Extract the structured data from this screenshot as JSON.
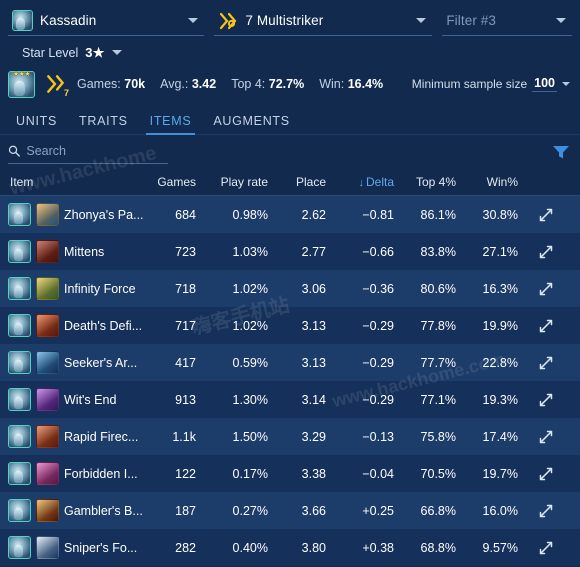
{
  "filters": {
    "champion": {
      "name": "Kassadin",
      "icon": "champion-portrait-icon"
    },
    "trait": {
      "name": "7 Multistriker",
      "icon": "multistriker-trait-icon"
    },
    "third": {
      "placeholder": "Filter #3"
    },
    "star_level": {
      "label": "Star Level",
      "value": "3★"
    }
  },
  "stats": {
    "games_label": "Games:",
    "games_value": "70k",
    "avg_label": "Avg.:",
    "avg_value": "3.42",
    "top4_label": "Top 4:",
    "top4_value": "72.7%",
    "win_label": "Win:",
    "win_value": "16.4%",
    "trait_count": "7",
    "min_sample_label": "Minimum sample size",
    "min_sample_value": "100"
  },
  "tabs": [
    {
      "label": "UNITS",
      "active": false
    },
    {
      "label": "TRAITS",
      "active": false
    },
    {
      "label": "ITEMS",
      "active": true
    },
    {
      "label": "AUGMENTS",
      "active": false
    }
  ],
  "search": {
    "placeholder": "Search",
    "value": ""
  },
  "columns": {
    "item": "Item",
    "games": "Games",
    "play_rate": "Play rate",
    "place": "Place",
    "delta": "Delta",
    "delta_sort": "↓",
    "top4": "Top 4%",
    "win": "Win%"
  },
  "colors": {
    "page_bg": "#122a4d",
    "row_odd": "#1c3c69",
    "row_even": "#15305a",
    "accent_blue": "#3f8fe0",
    "sort_blue": "#63a8ef",
    "trait_gold": "#f5c518",
    "champ_border": "#4fd4c0"
  },
  "rows": [
    {
      "name": "Zhonya's Pa...",
      "games": "684",
      "play_rate": "0.98%",
      "place": "2.62",
      "delta": "−0.81",
      "top4": "86.1%",
      "win": "30.8%",
      "item_color_a": "#e8a23a",
      "item_color_b": "#2b6ea8"
    },
    {
      "name": "Mittens",
      "games": "723",
      "play_rate": "1.03%",
      "place": "2.77",
      "delta": "−0.66",
      "top4": "83.8%",
      "win": "27.1%",
      "item_color_a": "#b5402c",
      "item_color_b": "#5c1a14"
    },
    {
      "name": "Infinity Force",
      "games": "718",
      "play_rate": "1.02%",
      "place": "3.06",
      "delta": "−0.36",
      "top4": "80.6%",
      "win": "16.3%",
      "item_color_a": "#e8c23a",
      "item_color_b": "#3e7a3a"
    },
    {
      "name": "Death's Defi...",
      "games": "717",
      "play_rate": "1.02%",
      "place": "3.13",
      "delta": "−0.29",
      "top4": "77.8%",
      "win": "19.9%",
      "item_color_a": "#e2622a",
      "item_color_b": "#7a1f12"
    },
    {
      "name": "Seeker's Ar...",
      "games": "417",
      "play_rate": "0.59%",
      "place": "3.13",
      "delta": "−0.29",
      "top4": "77.7%",
      "win": "22.8%",
      "item_color_a": "#4aa8e0",
      "item_color_b": "#1b3f78"
    },
    {
      "name": "Wit's End",
      "games": "913",
      "play_rate": "1.30%",
      "place": "3.14",
      "delta": "−0.29",
      "top4": "77.1%",
      "win": "19.3%",
      "item_color_a": "#b05ce0",
      "item_color_b": "#4a1f7a"
    },
    {
      "name": "Rapid Firec...",
      "games": "1.1k",
      "play_rate": "1.50%",
      "place": "3.29",
      "delta": "−0.13",
      "top4": "75.8%",
      "win": "17.4%",
      "item_color_a": "#e06a3a",
      "item_color_b": "#7a2410"
    },
    {
      "name": "Forbidden I...",
      "games": "122",
      "play_rate": "0.17%",
      "place": "3.38",
      "delta": "−0.04",
      "top4": "70.5%",
      "win": "19.7%",
      "item_color_a": "#e060b8",
      "item_color_b": "#7a1f5a"
    },
    {
      "name": "Gambler's B...",
      "games": "187",
      "play_rate": "0.27%",
      "place": "3.66",
      "delta": "+0.25",
      "top4": "66.8%",
      "win": "16.0%",
      "item_color_a": "#e8a83a",
      "item_color_b": "#6a1a10"
    },
    {
      "name": "Sniper's Fo...",
      "games": "282",
      "play_rate": "0.40%",
      "place": "3.80",
      "delta": "+0.38",
      "top4": "68.8%",
      "win": "9.57%",
      "item_color_a": "#cfe4f5",
      "item_color_b": "#1f4a86"
    }
  ],
  "icons": {
    "search": "search-icon",
    "filter": "filter-funnel-icon",
    "expand": "expand-diagonal-icon",
    "caret": "chevron-down-icon"
  }
}
